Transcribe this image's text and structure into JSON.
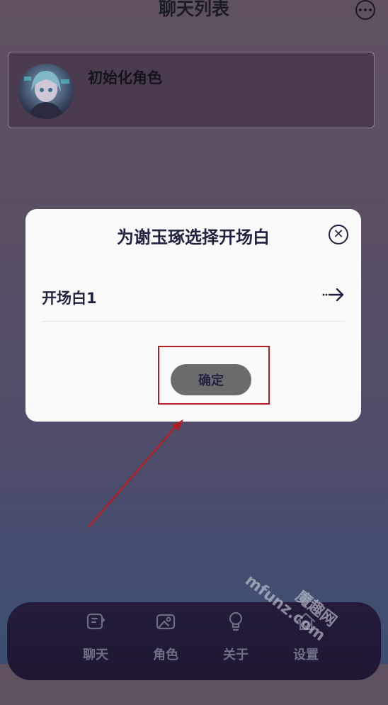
{
  "header": {
    "title": "聊天列表"
  },
  "chat_list": [
    {
      "name": "初始化角色"
    }
  ],
  "dialog": {
    "title": "为谢玉琢选择开场白",
    "options": [
      {
        "label": "开场白1"
      }
    ],
    "confirm_label": "确定"
  },
  "tabbar": {
    "items": [
      {
        "label": "聊天",
        "icon": "chat-icon"
      },
      {
        "label": "角色",
        "icon": "character-icon"
      },
      {
        "label": "关于",
        "icon": "bulb-icon"
      },
      {
        "label": "设置",
        "icon": "home-settings-icon"
      }
    ]
  },
  "watermark": {
    "line1": "魔趣网",
    "line2": "mfunz.com"
  },
  "colors": {
    "annotation_red": "#b11f24",
    "dialog_bg": "#fafafa",
    "confirm_bg": "#6b6b6b",
    "text_dark": "#1e2340"
  }
}
